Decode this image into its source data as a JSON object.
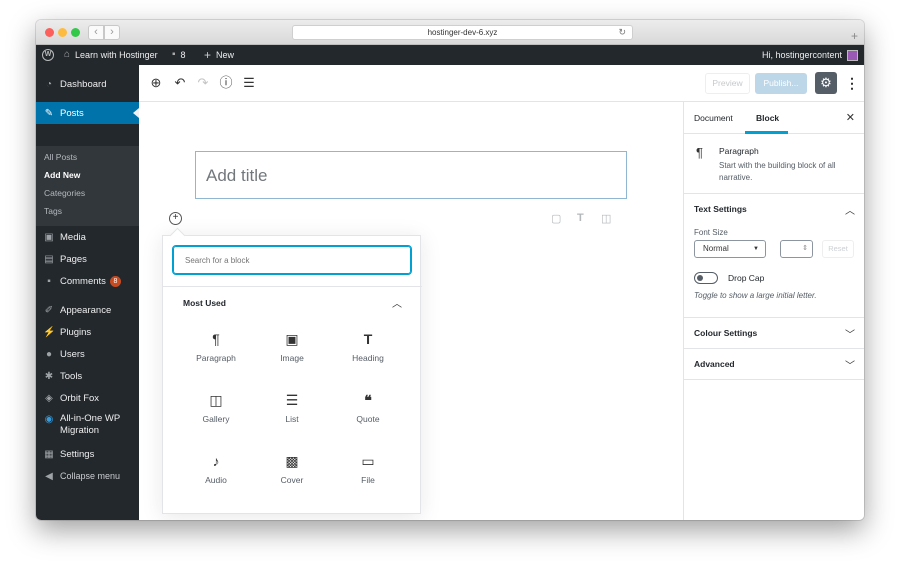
{
  "browser": {
    "url": "hostinger-dev-6.xyz"
  },
  "adminbar": {
    "site_name": "Learn with Hostinger",
    "comments_count": "8",
    "new_label": "New",
    "greeting": "Hi, hostingercontent"
  },
  "sidebar": {
    "items": [
      {
        "label": "Dashboard",
        "icon": "dashboard-icon"
      },
      {
        "label": "Posts",
        "icon": "pin-icon"
      },
      {
        "label": "Media",
        "icon": "media-icon"
      },
      {
        "label": "Pages",
        "icon": "pages-icon"
      },
      {
        "label": "Comments",
        "icon": "comments-icon",
        "badge": "8"
      },
      {
        "label": "Appearance",
        "icon": "brush-icon"
      },
      {
        "label": "Plugins",
        "icon": "plug-icon"
      },
      {
        "label": "Users",
        "icon": "users-icon"
      },
      {
        "label": "Tools",
        "icon": "wrench-icon"
      },
      {
        "label": "Orbit Fox",
        "icon": "fox-icon"
      },
      {
        "label": "All-in-One WP Migration",
        "icon": "migration-icon"
      },
      {
        "label": "Settings",
        "icon": "settings-icon"
      },
      {
        "label": "Collapse menu",
        "icon": "collapse-icon"
      }
    ],
    "posts_submenu": [
      "All Posts",
      "Add New",
      "Categories",
      "Tags"
    ]
  },
  "toolbar": {
    "preview_label": "Preview",
    "publish_label": "Publish..."
  },
  "editor": {
    "title_placeholder": "Add title"
  },
  "inserter": {
    "search_placeholder": "Search for a block",
    "panel_title": "Most Used",
    "blocks": [
      {
        "label": "Paragraph",
        "icon": "paragraph-icon"
      },
      {
        "label": "Image",
        "icon": "image-icon"
      },
      {
        "label": "Heading",
        "icon": "heading-icon"
      },
      {
        "label": "Gallery",
        "icon": "gallery-icon"
      },
      {
        "label": "List",
        "icon": "list-icon"
      },
      {
        "label": "Quote",
        "icon": "quote-icon"
      },
      {
        "label": "Audio",
        "icon": "audio-icon"
      },
      {
        "label": "Cover",
        "icon": "cover-icon"
      },
      {
        "label": "File",
        "icon": "file-icon"
      }
    ]
  },
  "settings": {
    "tab_document": "Document",
    "tab_block": "Block",
    "block_name": "Paragraph",
    "block_description": "Start with the building block of all narrative.",
    "text_settings_title": "Text Settings",
    "font_size_label": "Font Size",
    "font_size_value": "Normal",
    "reset_label": "Reset",
    "drop_cap_label": "Drop Cap",
    "drop_cap_help": "Toggle to show a large initial letter.",
    "colour_settings_title": "Colour Settings",
    "advanced_title": "Advanced"
  },
  "colors": {
    "admin_dark": "#23282d",
    "accent_blue": "#0073aa",
    "focus_blue": "#00a0d2",
    "badge_orange": "#ca4a1f"
  }
}
